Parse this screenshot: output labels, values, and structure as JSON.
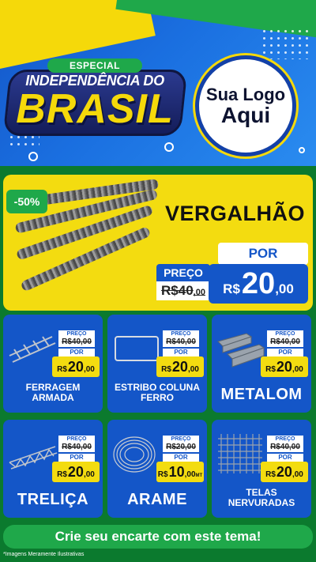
{
  "header": {
    "badge": "ESPECIAL",
    "title_line1": "INDEPENDÊNCIA DO",
    "title_line2": "BRASIL",
    "logo_line1": "Sua Logo",
    "logo_line2": "Aqui"
  },
  "featured": {
    "discount": "-50%",
    "name": "VERGALHÃO",
    "preco_label": "PREÇO",
    "old_price_int": "R$40",
    "old_price_dec": ",00",
    "por_label": "POR",
    "currency": "R$",
    "price_int": "20",
    "price_dec": ",00"
  },
  "cards": [
    {
      "name": "FERRAGEM ARMADA",
      "preco_label": "PREÇO",
      "old": "R$40,00",
      "por": "POR",
      "currency": "R$",
      "int": "20",
      "dec": ",00"
    },
    {
      "name": "ESTRIBO COLUNA FERRO",
      "preco_label": "PREÇO",
      "old": "R$40,00",
      "por": "POR",
      "currency": "R$",
      "int": "20",
      "dec": ",00"
    },
    {
      "name": "METALOM",
      "preco_label": "PREÇO",
      "old": "R$40,00",
      "por": "POR",
      "currency": "R$",
      "int": "20",
      "dec": ",00"
    },
    {
      "name": "TRELIÇA",
      "preco_label": "PREÇO",
      "old": "R$40,00",
      "por": "POR",
      "currency": "R$",
      "int": "20",
      "dec": ",00"
    },
    {
      "name": "ARAME",
      "preco_label": "PREÇO",
      "old": "R$20,00",
      "por": "POR",
      "currency": "R$",
      "int": "10",
      "dec": ",00",
      "unit": "MT"
    },
    {
      "name": "TELAS NERVURADAS",
      "preco_label": "PREÇO",
      "old": "R$40,00",
      "por": "POR",
      "currency": "R$",
      "int": "20",
      "dec": ",00"
    }
  ],
  "cta": "Crie seu encarte com este tema!",
  "footnote": "*Imagens Meramente Ilustrativas",
  "colors": {
    "blue": "#1456c8",
    "yellow": "#f3dc10",
    "green": "#1fa84a",
    "dark_green": "#0b7a2e"
  }
}
